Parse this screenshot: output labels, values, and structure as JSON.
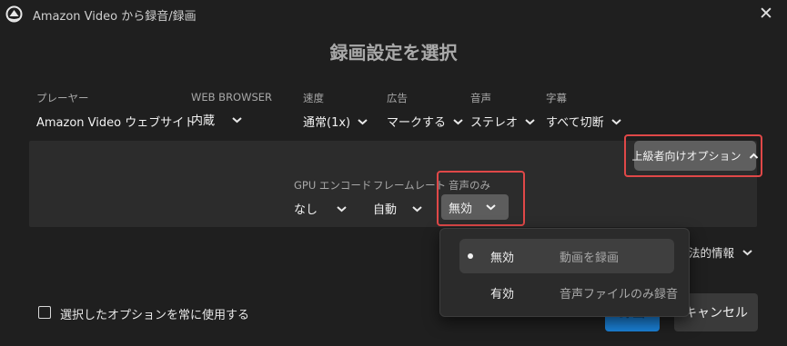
{
  "window": {
    "title": "Amazon Video から録音/録画",
    "close_glyph": "✕"
  },
  "dialog": {
    "heading": "録画設定を選択"
  },
  "options": [
    {
      "label": "プレーヤー",
      "value": "Amazon Video ウェブサイト"
    },
    {
      "label": "WEB BROWSER",
      "value": "内蔵"
    },
    {
      "label": "速度",
      "value": "通常(1x)"
    },
    {
      "label": "広告",
      "value": "マークする"
    },
    {
      "label": "音声",
      "value": "ステレオ"
    },
    {
      "label": "字幕",
      "value": "すべて切断"
    }
  ],
  "advanced": {
    "toggle_label": "上級者向けオプション",
    "options": [
      {
        "label": "GPU エンコード",
        "value": "なし"
      },
      {
        "label": "フレームレート",
        "value": "自動"
      },
      {
        "label": "音声のみ",
        "value": "無効"
      }
    ]
  },
  "legal": {
    "label": "法的情報"
  },
  "remember": {
    "label": "選択したオプションを常に使用する",
    "checked": false
  },
  "buttons": {
    "record": "録画",
    "cancel": "キャンセル"
  },
  "audio_only_menu": {
    "items": [
      {
        "label": "無効",
        "description": "動画を録画",
        "selected": true
      },
      {
        "label": "有効",
        "description": "音声ファイルのみ録音",
        "selected": false
      }
    ]
  },
  "colors": {
    "background": "#1f1f1f",
    "panel": "#2c2c2c",
    "highlight_outline": "#e04848",
    "primary_button": "#1a7fd4"
  },
  "icons": {
    "app": "amazon-logo-icon",
    "close": "close-icon",
    "dropdown": "chevron-down-icon",
    "collapse": "chevron-up-icon"
  }
}
